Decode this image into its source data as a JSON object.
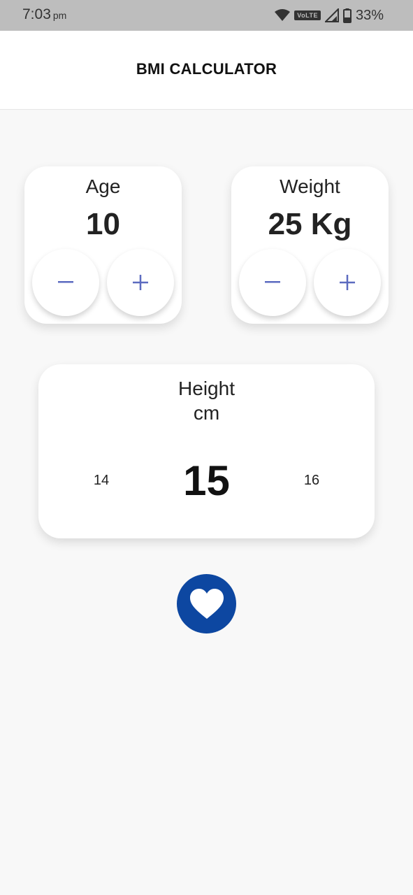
{
  "status_bar": {
    "time": "7:03",
    "ampm": "pm",
    "network": "VoLTE",
    "battery": "33%"
  },
  "app_bar": {
    "title": "BMI CALCULATOR"
  },
  "age_card": {
    "label": "Age",
    "value": "10"
  },
  "weight_card": {
    "label": "Weight",
    "value": "25 Kg"
  },
  "height_card": {
    "label": "Height",
    "unit": "cm",
    "prev": "14",
    "current": "15",
    "next": "16"
  },
  "icons": {
    "minus": "minus-icon",
    "plus": "plus-icon",
    "fab": "heart-icon"
  },
  "colors": {
    "accent": "#5c6bc0",
    "fab": "#0d47a1",
    "background": "#f8f8f8",
    "status_bar": "#bdbdbd"
  }
}
